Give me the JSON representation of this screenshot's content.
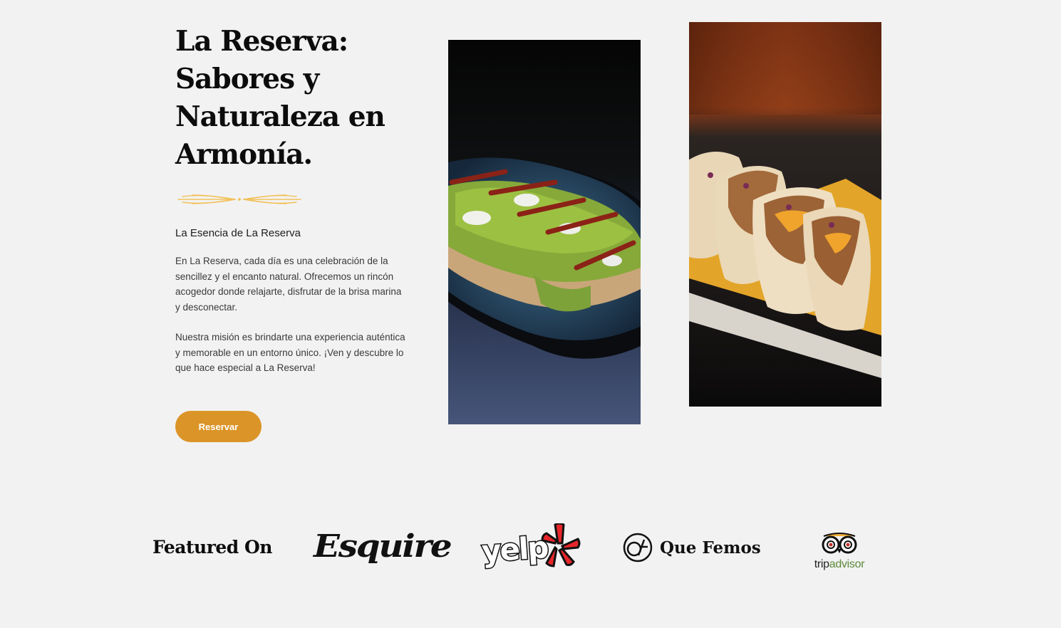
{
  "intro": {
    "title_lines": [
      "La Reserva:",
      "Sabores y",
      "Naturaleza en",
      "Armonía."
    ],
    "subtitle": "La Esencia de La Reserva",
    "paragraph1": "En La Reserva, cada día es una celebración de la sencillez y el encanto natural. Ofrecemos un rincón acogedor donde relajarte, disfrutar de la brisa marina y desconectar.",
    "paragraph2": "Nuestra misión es brindarte una experiencia auténtica y memorable en un entorno único. ¡Ven y descubre lo que hace especial a La Reserva!",
    "cta_label": "Reservar"
  },
  "colors": {
    "background": "#f2f2f2",
    "accent": "#db9427",
    "divider": "#f2c15a"
  },
  "images": [
    {
      "icon": "toast-with-green-sauce-photo"
    },
    {
      "icon": "tacos-photo"
    }
  ],
  "featured": {
    "title": "Featured On",
    "logos": {
      "esquire": "Esquire",
      "yelp": "yelp",
      "quefemos": "Que Femos",
      "tripadvisor_a": "trip",
      "tripadvisor_b": "advisor"
    }
  }
}
